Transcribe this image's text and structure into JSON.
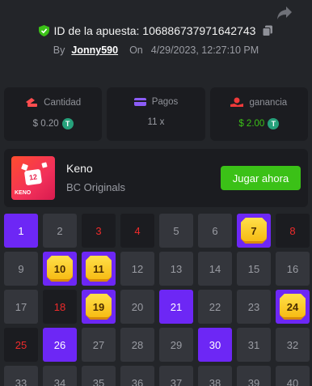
{
  "header": {
    "bet_label": "ID de la apuesta: 106886737971642743",
    "by_prefix": "By",
    "username": "Jonny590",
    "on_prefix": "On",
    "datetime": "4/29/2023, 12:27:10 PM"
  },
  "stats": [
    {
      "label": "Cantidad",
      "value": "$ 0.20",
      "icon": "money-icon",
      "accent": "#ff4d4f"
    },
    {
      "label": "Pagos",
      "value": "11 x",
      "icon": "wallet-icon",
      "accent": "#8b5cf6"
    },
    {
      "label": "ganancia",
      "value": "$ 2.00",
      "icon": "profit-icon",
      "accent": "#ef3a3a"
    }
  ],
  "game": {
    "name": "Keno",
    "provider": "BC Originals",
    "thumb_number": "12",
    "thumb_label": "KENO",
    "play_label": "Jugar ahora"
  },
  "currency_symbol": "T",
  "colors": {
    "accent_purple": "#6d27f5",
    "win_green": "#3bc117",
    "miss_red": "#ef2b2b",
    "tile_gold": "#f6b80f"
  },
  "grid": {
    "cells": [
      {
        "n": "1",
        "state": "pick"
      },
      {
        "n": "2",
        "state": "normal"
      },
      {
        "n": "3",
        "state": "drawn"
      },
      {
        "n": "4",
        "state": "drawn"
      },
      {
        "n": "5",
        "state": "normal"
      },
      {
        "n": "6",
        "state": "normal"
      },
      {
        "n": "7",
        "state": "hit"
      },
      {
        "n": "8",
        "state": "drawn"
      },
      {
        "n": "9",
        "state": "normal"
      },
      {
        "n": "10",
        "state": "hit"
      },
      {
        "n": "11",
        "state": "hit"
      },
      {
        "n": "12",
        "state": "normal"
      },
      {
        "n": "13",
        "state": "normal"
      },
      {
        "n": "14",
        "state": "normal"
      },
      {
        "n": "15",
        "state": "normal"
      },
      {
        "n": "16",
        "state": "normal"
      },
      {
        "n": "17",
        "state": "normal"
      },
      {
        "n": "18",
        "state": "drawn"
      },
      {
        "n": "19",
        "state": "hit"
      },
      {
        "n": "20",
        "state": "normal"
      },
      {
        "n": "21",
        "state": "pick"
      },
      {
        "n": "22",
        "state": "normal"
      },
      {
        "n": "23",
        "state": "normal"
      },
      {
        "n": "24",
        "state": "hit"
      },
      {
        "n": "25",
        "state": "drawn"
      },
      {
        "n": "26",
        "state": "pick"
      },
      {
        "n": "27",
        "state": "normal"
      },
      {
        "n": "28",
        "state": "normal"
      },
      {
        "n": "29",
        "state": "normal"
      },
      {
        "n": "30",
        "state": "pick"
      },
      {
        "n": "31",
        "state": "normal"
      },
      {
        "n": "32",
        "state": "normal"
      },
      {
        "n": "33",
        "state": "normal"
      },
      {
        "n": "34",
        "state": "normal"
      },
      {
        "n": "35",
        "state": "normal"
      },
      {
        "n": "36",
        "state": "normal"
      },
      {
        "n": "37",
        "state": "normal"
      },
      {
        "n": "38",
        "state": "normal"
      },
      {
        "n": "39",
        "state": "normal"
      },
      {
        "n": "40",
        "state": "normal"
      }
    ]
  }
}
